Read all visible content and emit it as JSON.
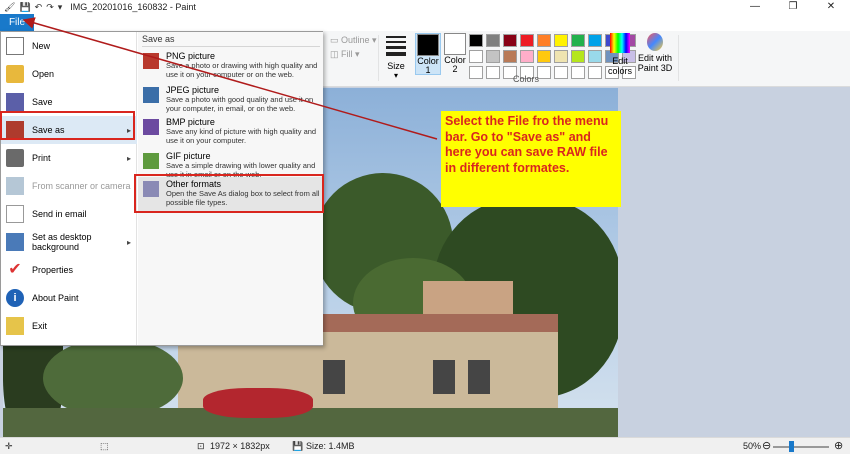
{
  "window": {
    "title": "IMG_20201016_160832 - Paint",
    "minimize": "—",
    "restore": "❐",
    "close": "✕"
  },
  "file_tab": "File",
  "ribbon": {
    "outline": "Outline",
    "fill": "Fill",
    "size": "Size",
    "color1": "Color 1",
    "color2": "Color 2",
    "colors_group": "Colors",
    "edit_colors": "Edit colors",
    "edit_paint3d": "Edit with Paint 3D",
    "palette": [
      "#000000",
      "#7f7f7f",
      "#880015",
      "#ed1c24",
      "#ff7f27",
      "#fff200",
      "#22b14c",
      "#00a2e8",
      "#3f48cc",
      "#a349a4",
      "#ffffff",
      "#c3c3c3",
      "#b97a57",
      "#ffaec9",
      "#ffc90e",
      "#efe4b0",
      "#b5e61d",
      "#99d9ea",
      "#7092be",
      "#c8bfe7",
      "#ffffff",
      "#ffffff",
      "#ffffff",
      "#ffffff",
      "#ffffff",
      "#ffffff",
      "#ffffff",
      "#ffffff",
      "#ffffff",
      "#ffffff"
    ]
  },
  "file_menu": {
    "items": [
      {
        "label": "New",
        "icon": "new-icon"
      },
      {
        "label": "Open",
        "icon": "open-icon"
      },
      {
        "label": "Save",
        "icon": "save-icon"
      },
      {
        "label": "Save as",
        "icon": "save-as-icon"
      },
      {
        "label": "Print",
        "icon": "print-icon"
      },
      {
        "label": "From scanner or camera",
        "icon": "scanner-icon"
      },
      {
        "label": "Send in email",
        "icon": "email-icon"
      },
      {
        "label": "Set as desktop background",
        "icon": "desktop-icon"
      },
      {
        "label": "Properties",
        "icon": "properties-icon"
      },
      {
        "label": "About Paint",
        "icon": "about-icon"
      },
      {
        "label": "Exit",
        "icon": "exit-icon"
      }
    ],
    "save_as_header": "Save as",
    "save_as_options": [
      {
        "title": "PNG picture",
        "desc": "Save a photo or drawing with high quality and use it on your computer or on the web."
      },
      {
        "title": "JPEG picture",
        "desc": "Save a photo with good quality and use it on your computer, in email, or on the web."
      },
      {
        "title": "BMP picture",
        "desc": "Save any kind of picture with high quality and use it on your computer."
      },
      {
        "title": "GIF picture",
        "desc": "Save a simple drawing with lower quality and use it in email or on the web."
      },
      {
        "title": "Other formats",
        "desc": "Open the Save As dialog box to select from all possible file types."
      }
    ]
  },
  "annotation": {
    "text": "Select the File fro the menu bar. Go to \"Save as\" and here you can save RAW file in different formates."
  },
  "statusbar": {
    "dimensions": "1972 × 1832px",
    "size": "Size: 1.4MB",
    "zoom": "50%"
  },
  "colors": {
    "accent": "#1979ca",
    "highlight_red": "#d9261e",
    "annotation_bg": "#ffff00"
  }
}
